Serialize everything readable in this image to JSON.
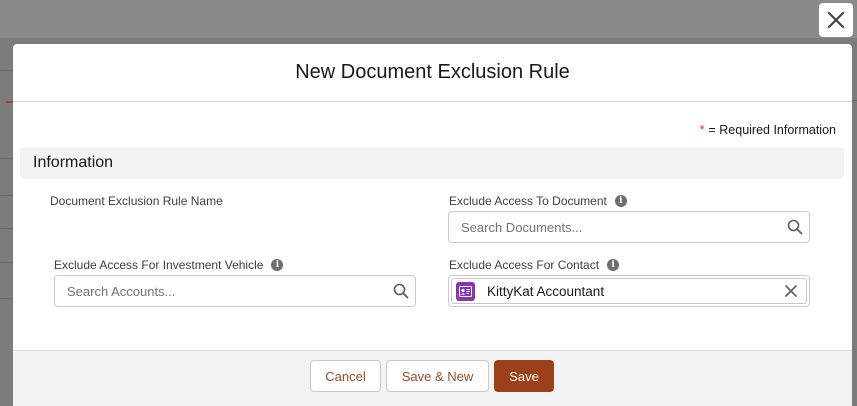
{
  "modal": {
    "title": "New Document Exclusion Rule",
    "required_star": "*",
    "required_text": "= Required Information",
    "section_title": "Information"
  },
  "fields": {
    "rule_name": {
      "label": "Document Exclusion Rule Name"
    },
    "exclude_document": {
      "label": "Exclude Access To Document",
      "placeholder": "Search Documents..."
    },
    "exclude_vehicle": {
      "label": "Exclude Access For Investment Vehicle",
      "placeholder": "Search Accounts..."
    },
    "exclude_contact": {
      "label": "Exclude Access For Contact",
      "selected_value": "KittyKat Accountant",
      "icon": "contact-card-icon"
    }
  },
  "footer": {
    "cancel_label": "Cancel",
    "save_new_label": "Save & New",
    "save_label": "Save"
  },
  "colors": {
    "brand": "#9b4019",
    "contact_icon": "#8a33b5",
    "required_star": "#c23934"
  }
}
